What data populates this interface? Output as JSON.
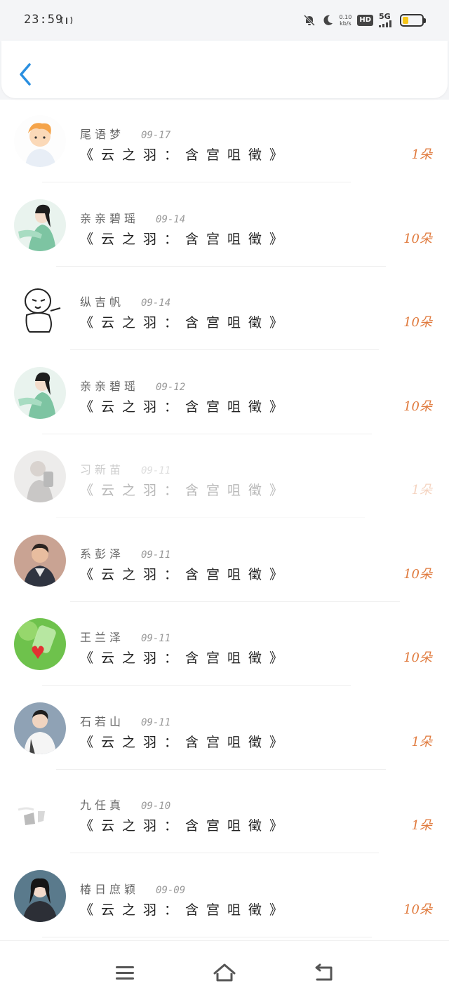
{
  "status_bar": {
    "time": "23:59",
    "speed_value": "0.10",
    "speed_unit": "kb/s",
    "hd_label": "HD",
    "network_label": "5G"
  },
  "colors": {
    "accent": "#2a8fe0",
    "count": "#e07a3d"
  },
  "records": [
    {
      "name": "尾语梦",
      "date": "09-17",
      "gift": "《云之羽：含宫咀徵》",
      "count": "1朵",
      "avatar": "cartoon-boy-avatar",
      "faded": false
    },
    {
      "name": "亲亲碧瑶",
      "date": "09-14",
      "gift": "《云之羽：含宫咀徵》",
      "count": "10朵",
      "avatar": "costume-girl-avatar",
      "faded": false
    },
    {
      "name": "纵吉帆",
      "date": "09-14",
      "gift": "《云之羽：含宫咀徵》",
      "count": "10朵",
      "avatar": "sketch-doodle-avatar",
      "faded": false
    },
    {
      "name": "亲亲碧瑶",
      "date": "09-12",
      "gift": "《云之羽：含宫咀徵》",
      "count": "10朵",
      "avatar": "costume-girl-avatar",
      "faded": false
    },
    {
      "name": "习新苗",
      "date": "09-11",
      "gift": "《云之羽：含宫咀徵》",
      "count": "1朵",
      "avatar": "selfie-avatar",
      "faded": true
    },
    {
      "name": "系彭泽",
      "date": "09-11",
      "gift": "《云之羽：含宫咀徵》",
      "count": "10朵",
      "avatar": "actor-avatar",
      "faded": false
    },
    {
      "name": "王兰泽",
      "date": "09-11",
      "gift": "《云之羽：含宫咀徵》",
      "count": "10朵",
      "avatar": "green-bottle-heart-avatar",
      "faded": false
    },
    {
      "name": "石若山",
      "date": "09-11",
      "gift": "《云之羽：含宫咀徵》",
      "count": "1朵",
      "avatar": "young-man-avatar",
      "faded": false
    },
    {
      "name": "九任真",
      "date": "09-10",
      "gift": "《云之羽：含宫咀徵》",
      "count": "1朵",
      "avatar": "blank-sketch-avatar",
      "faded": false
    },
    {
      "name": "椿日庶颖",
      "date": "09-09",
      "gift": "《云之羽：含宫咀徵》",
      "count": "10朵",
      "avatar": "woman-portrait-avatar",
      "faded": false
    }
  ],
  "nav": {
    "menu_icon": "menu-icon",
    "home_icon": "home-icon",
    "back_icon": "return-icon"
  }
}
